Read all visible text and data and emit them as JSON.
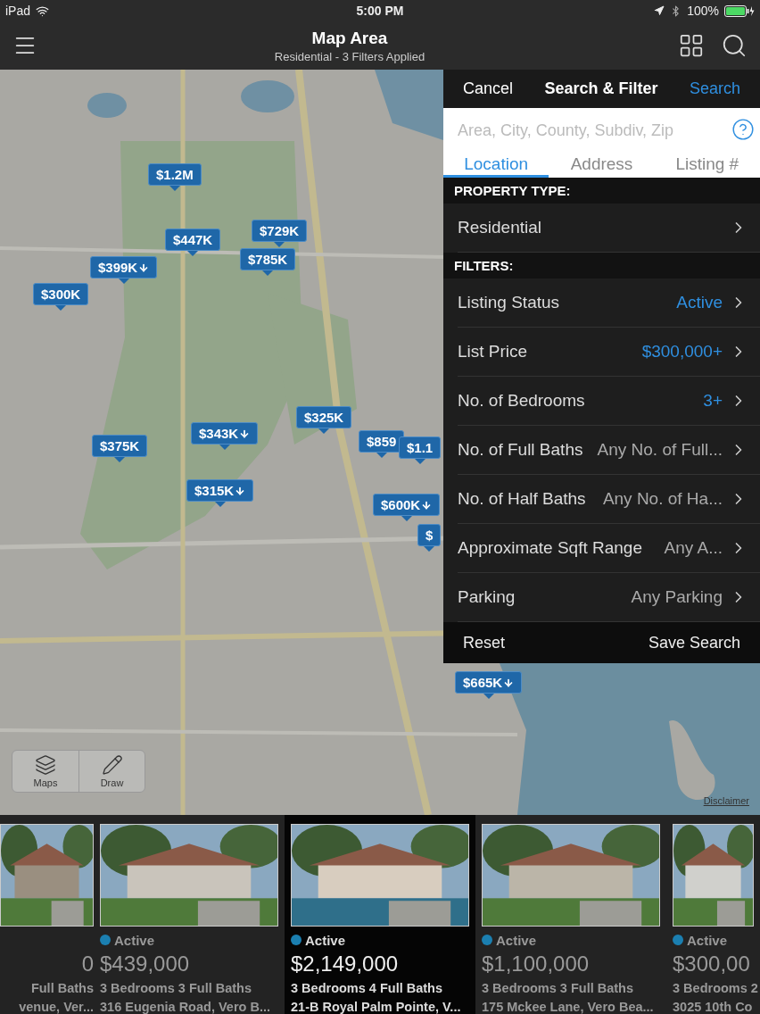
{
  "status_bar": {
    "device": "iPad",
    "time": "5:00 PM",
    "battery": "100%"
  },
  "nav": {
    "title": "Map Area",
    "subtitle": "Residential - 3 Filters Applied"
  },
  "map": {
    "pins": [
      {
        "label": "$1.2M",
        "reduced": false
      },
      {
        "label": "$447K",
        "reduced": false
      },
      {
        "label": "$729K",
        "reduced": false
      },
      {
        "label": "$785K",
        "reduced": false
      },
      {
        "label": "$399K",
        "reduced": true
      },
      {
        "label": "$300K",
        "reduced": false
      },
      {
        "label": "$325K",
        "reduced": false
      },
      {
        "label": "$343K",
        "reduced": true
      },
      {
        "label": "$375K",
        "reduced": false
      },
      {
        "label": "$859",
        "reduced": false
      },
      {
        "label": "$1.1",
        "reduced": false
      },
      {
        "label": "$315K",
        "reduced": true
      },
      {
        "label": "$600K",
        "reduced": true
      },
      {
        "label": "$",
        "reduced": false
      },
      {
        "label": "$665K",
        "reduced": true
      }
    ],
    "tools": [
      {
        "label": "Maps",
        "kind": "layers"
      },
      {
        "label": "Draw",
        "kind": "pencil"
      }
    ],
    "disclaimer": "Disclaimer"
  },
  "filter_panel": {
    "cancel": "Cancel",
    "title": "Search & Filter",
    "search": "Search",
    "search_field": {
      "placeholder": "Area, City, County, Subdiv, Zip"
    },
    "tabs": [
      {
        "label": "Location",
        "selected": true
      },
      {
        "label": "Address",
        "selected": false
      },
      {
        "label": "Listing #",
        "selected": false
      }
    ],
    "sections": [
      {
        "heading": "PROPERTY TYPE:",
        "rows": [
          {
            "label": "Residential"
          }
        ]
      },
      {
        "heading": "FILTERS:",
        "rows": [
          {
            "label": "Listing Status",
            "value": "Active",
            "set": true
          },
          {
            "label": "List Price",
            "value": "$300,000+",
            "set": true
          },
          {
            "label": "No. of Bedrooms",
            "value": "3+",
            "set": true
          },
          {
            "label": "No. of Full Baths",
            "value": "Any No. of Full...",
            "set": false
          },
          {
            "label": "No. of Half Baths",
            "value": "Any No. of Ha...",
            "set": false
          },
          {
            "label": "Approximate Sqft Range",
            "value": "Any A...",
            "set": false
          },
          {
            "label": "Parking",
            "value": "Any Parking",
            "set": false
          }
        ]
      }
    ],
    "reset": "Reset",
    "save": "Save Search"
  },
  "listings": [
    {
      "price": "0",
      "beds": "Full Baths",
      "address": "venue, Ver...",
      "selected": false
    },
    {
      "status": {
        "label": "Active",
        "color": "#1b7fb0"
      },
      "price": "$439,000",
      "beds": "3 Bedrooms 3 Full Baths",
      "address": "316 Eugenia Road, Vero B...",
      "selected": false
    },
    {
      "status": {
        "label": "Active",
        "color": "#1b7fb0"
      },
      "price": "$2,149,000",
      "beds": "3 Bedrooms 4 Full Baths",
      "address": "21-B Royal Palm Pointe, V...",
      "selected": true
    },
    {
      "status": {
        "label": "Active",
        "color": "#1b7fb0"
      },
      "price": "$1,100,000",
      "beds": "3 Bedrooms 3 Full Baths",
      "address": "175 Mckee Lane, Vero Bea...",
      "selected": false
    },
    {
      "status": {
        "label": "Active",
        "color": "#1b7fb0"
      },
      "price": "$300,00",
      "beds": "3 Bedrooms 2",
      "address": "3025 10th Co",
      "selected": false
    }
  ]
}
